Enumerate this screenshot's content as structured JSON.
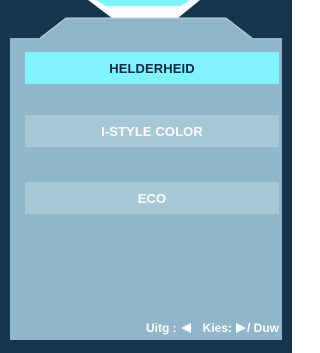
{
  "osd": {
    "menu_items": [
      {
        "label": "HELDERHEID",
        "selected": true
      },
      {
        "label": "I-STYLE COLOR",
        "selected": false
      },
      {
        "label": "ECO",
        "selected": false
      }
    ],
    "footer": {
      "exit_label": "Uitg :",
      "exit_icon": "triangle-left-icon",
      "select_label": "Kies:",
      "select_icon": "triangle-right-icon",
      "push_label": "/ Duw"
    },
    "colors": {
      "frame_dark": "#16364f",
      "panel_fill": "#8fb7c9",
      "selected_bg": "#7ff4ff",
      "item_bg": "#a6c8d6",
      "text_light": "#ffffff",
      "text_dark": "#0c2a40"
    }
  }
}
